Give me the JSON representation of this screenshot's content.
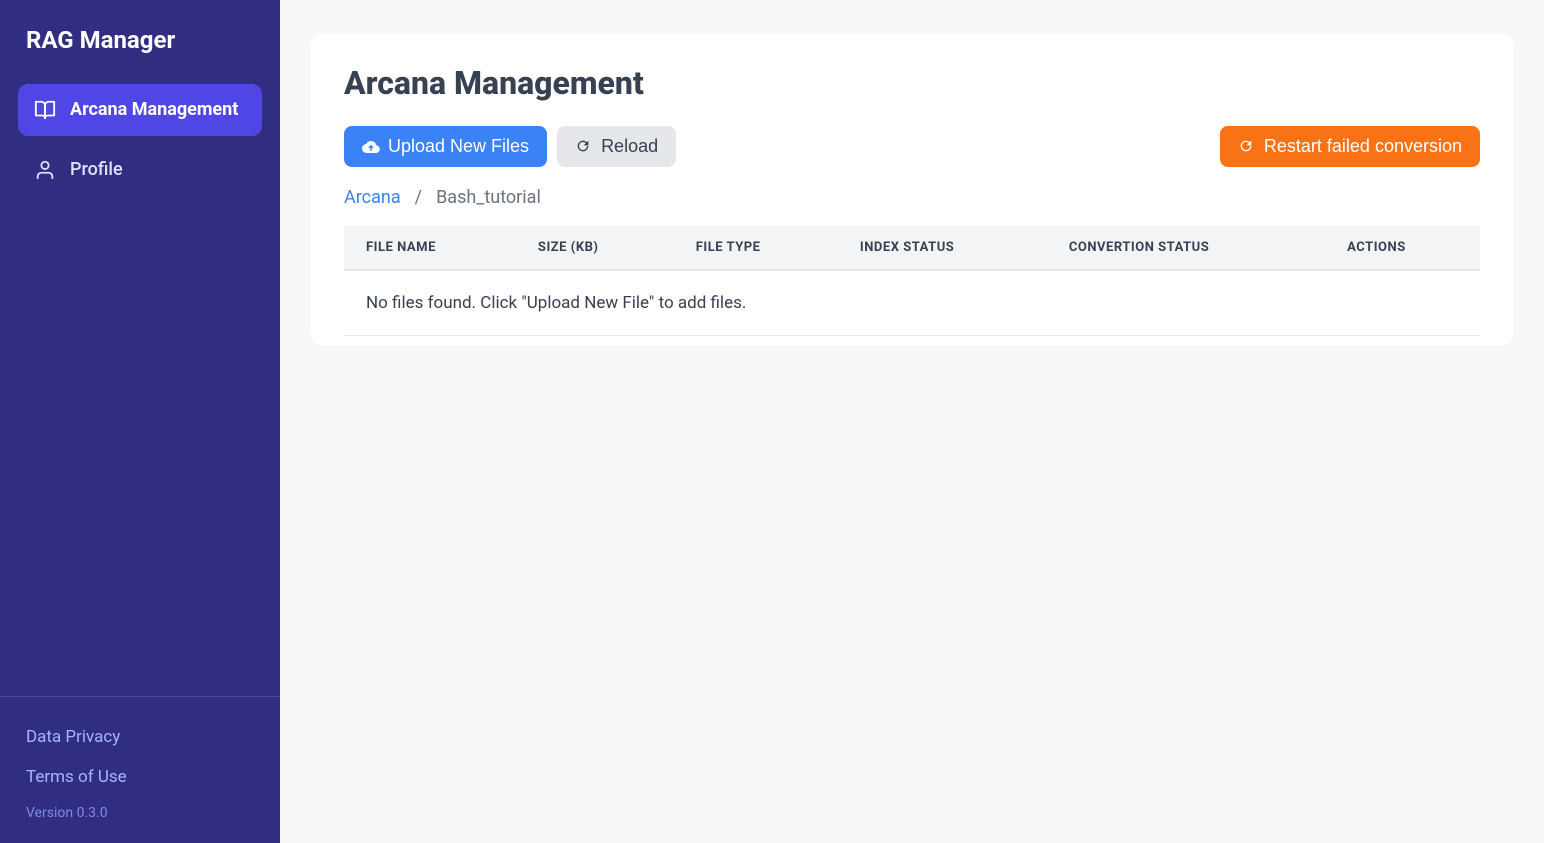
{
  "brand": "RAG Manager",
  "sidebar": {
    "items": [
      {
        "label": "Arcana Management",
        "icon": "book-open-icon",
        "active": true
      },
      {
        "label": "Profile",
        "icon": "user-icon",
        "active": false
      }
    ],
    "footer_links": [
      {
        "label": "Data Privacy"
      },
      {
        "label": "Terms of Use"
      }
    ],
    "version": "Version 0.3.0"
  },
  "page": {
    "title": "Arcana Management"
  },
  "toolbar": {
    "upload_label": "Upload New Files",
    "reload_label": "Reload",
    "restart_label": "Restart failed conversion"
  },
  "breadcrumb": {
    "root": "Arcana",
    "sep": "/",
    "current": "Bash_tutorial"
  },
  "table": {
    "columns": [
      "FILE NAME",
      "SIZE (KB)",
      "FILE TYPE",
      "INDEX STATUS",
      "CONVERTION STATUS",
      "ACTIONS"
    ],
    "empty_message": "No files found. Click \"Upload New File\" to add files."
  }
}
